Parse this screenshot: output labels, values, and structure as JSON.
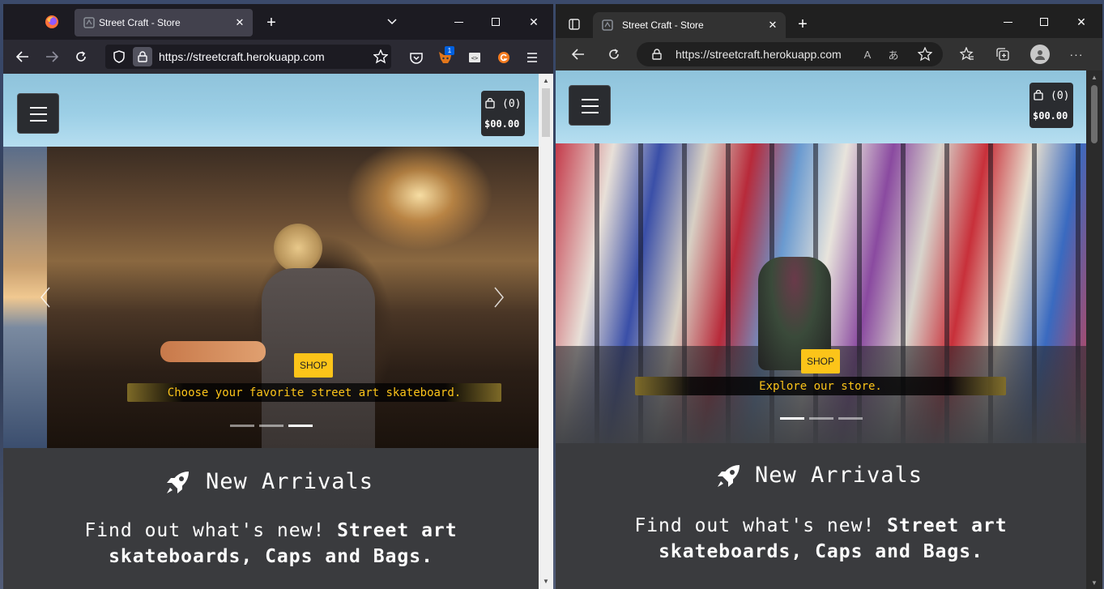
{
  "site": {
    "tab_title": "Street Craft - Store",
    "url": "https://streetcraft.herokuapp.com",
    "cart": {
      "count": "(0)",
      "total": "$00.00"
    },
    "shop_label": "SHOP",
    "arrivals": {
      "title": "New Arrivals",
      "text_plain": "Find out what's new!",
      "text_bold": "Street art skateboards, Caps and Bags."
    }
  },
  "left_window": {
    "browser": "Firefox",
    "notification_badge": "1",
    "slide_caption": "Choose your favorite street art skateboard.",
    "carousel": {
      "slides": 3,
      "active_index": 2
    }
  },
  "right_window": {
    "browser": "Edge",
    "slide_caption": "Explore our store.",
    "carousel": {
      "slides": 3,
      "active_index": 0
    }
  },
  "colors": {
    "accent_yellow": "#fcc419",
    "header_sky": "#9ccfe6",
    "content_bg": "#3a3b3e"
  }
}
